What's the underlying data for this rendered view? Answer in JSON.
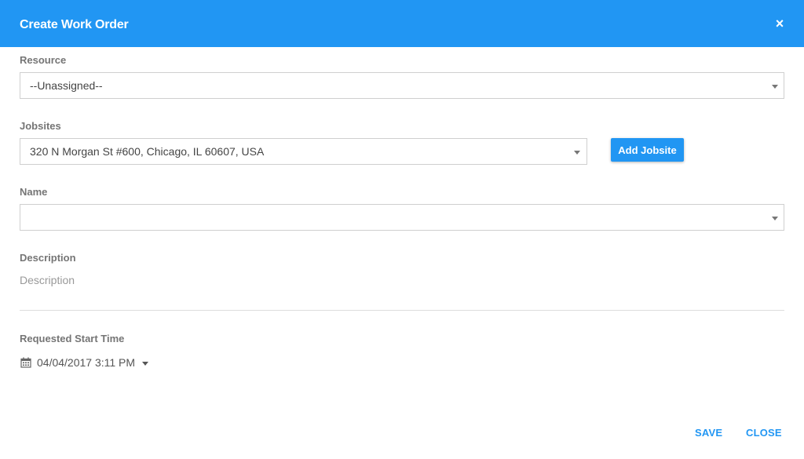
{
  "dialog": {
    "title": "Create Work Order",
    "close_glyph": "×"
  },
  "resource": {
    "label": "Resource",
    "value": "--Unassigned--"
  },
  "jobsites": {
    "label": "Jobsites",
    "value": "320 N Morgan St #600, Chicago, IL 60607, USA",
    "add_button": "Add Jobsite"
  },
  "name": {
    "label": "Name",
    "value": ""
  },
  "description": {
    "label": "Description",
    "placeholder": "Description",
    "value": ""
  },
  "start_time": {
    "label": "Requested Start Time",
    "value": "04/04/2017 3:11 PM",
    "icon": "calendar-icon"
  },
  "footer": {
    "save_label": "SAVE",
    "close_label": "CLOSE"
  },
  "colors": {
    "primary": "#2196f3",
    "label": "#757575",
    "border": "#cfcfcf"
  }
}
